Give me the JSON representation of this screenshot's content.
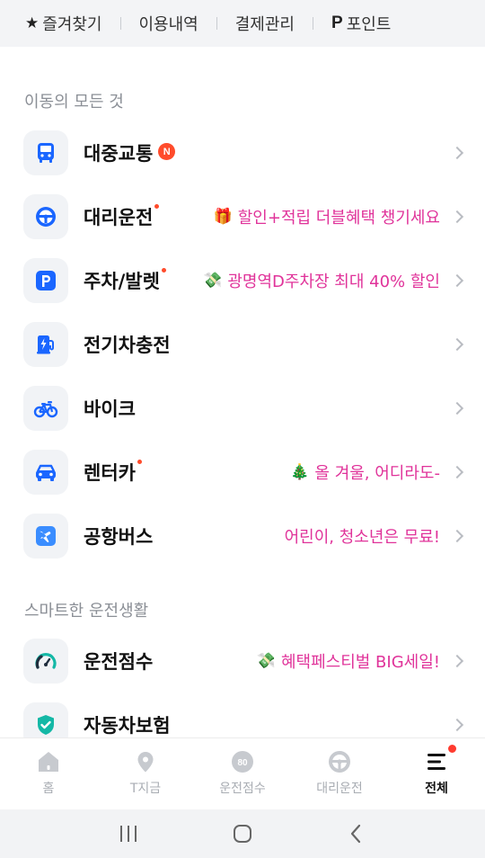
{
  "topbar": {
    "favorites": "즐겨찾기",
    "history": "이용내역",
    "payment": "결제관리",
    "points_mark": "P",
    "points": "포인트"
  },
  "sections": {
    "mobility": "이동의 모든 것",
    "smart_driving": "스마트한 운전생활"
  },
  "items": [
    {
      "label": "대중교통",
      "badge": "N",
      "icon": "bus-icon"
    },
    {
      "label": "대리운전",
      "promo_emoji": "🎁",
      "promo": "할인+적립 더블혜택 챙기세요",
      "icon": "steering-wheel-icon"
    },
    {
      "label": "주차/발렛",
      "promo_emoji": "💸",
      "promo": "광명역D주차장 최대 40% 할인",
      "icon": "parking-icon"
    },
    {
      "label": "전기차충전",
      "icon": "ev-charger-icon"
    },
    {
      "label": "바이크",
      "icon": "bike-icon"
    },
    {
      "label": "렌터카",
      "promo_emoji": "🎄",
      "promo": "올 겨울, 어디라도-",
      "icon": "car-icon"
    },
    {
      "label": "공항버스",
      "promo": "어린이, 청소년은 무료!",
      "icon": "airplane-icon"
    },
    {
      "label": "운전점수",
      "promo_emoji": "💸",
      "promo": "혜택페스티벌 BIG세일!",
      "icon": "gauge-icon"
    },
    {
      "label": "자동차보험",
      "icon": "shield-check-icon"
    }
  ],
  "bottom_nav": {
    "home": "홈",
    "tnow": "T지금",
    "score": "운전점수",
    "score_value": "80",
    "driver": "대리운전",
    "all": "전체"
  },
  "colors": {
    "accent_blue": "#1a66ff",
    "promo_pink": "#e0339a",
    "badge_red": "#ff4b2b"
  }
}
